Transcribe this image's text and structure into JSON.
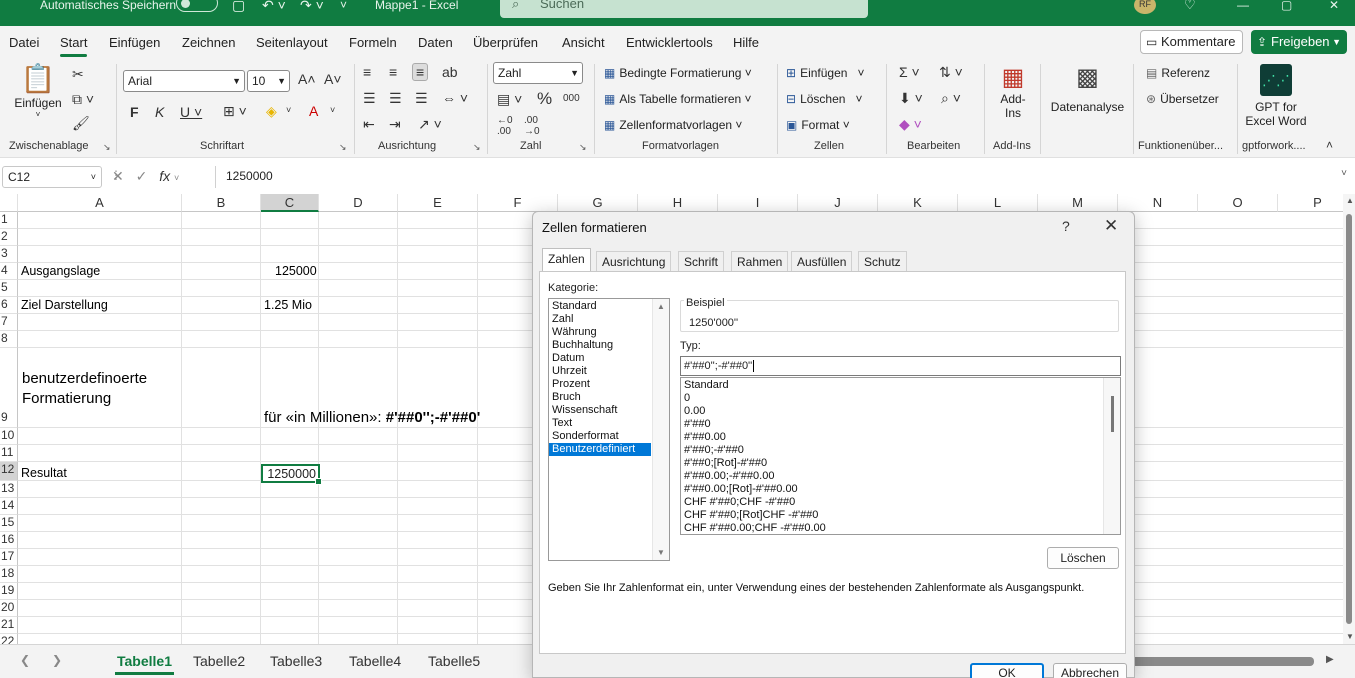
{
  "titlebar": {
    "autosave": "Automatisches Speichern",
    "doc_title": "Mappe1 - Excel",
    "search_placeholder": "Suchen",
    "avatar_initials": "RF"
  },
  "menu": {
    "tabs": [
      "Datei",
      "Start",
      "Einfügen",
      "Zeichnen",
      "Seitenlayout",
      "Formeln",
      "Daten",
      "Überprüfen",
      "Ansicht",
      "Entwicklertools",
      "Hilfe"
    ],
    "active_tab": "Start",
    "kommentare": "Kommentare",
    "freigeben": "Freigeben"
  },
  "ribbon": {
    "paste": "Einfügen",
    "font_name": "Arial",
    "font_size": "10",
    "number_format": "Zahl",
    "bedingte": "Bedingte Formatierung",
    "als_tabelle": "Als Tabelle formatieren",
    "zellenformat": "Zellenformatvorlagen",
    "einfuegen": "Einfügen",
    "loeschen": "Löschen",
    "format": "Format",
    "addins_line1": "Add-",
    "addins_line2": "Ins",
    "datenanalyse": "Datenanalyse",
    "referenz": "Referenz",
    "uebersetzer": "Übersetzer",
    "gpt_line1": "GPT for",
    "gpt_line2": "Excel Word",
    "groups": {
      "zwischenablage": "Zwischenablage",
      "schriftart": "Schriftart",
      "ausrichtung": "Ausrichtung",
      "zahl": "Zahl",
      "formatvorlagen": "Formatvorlagen",
      "zellen": "Zellen",
      "bearbeiten": "Bearbeiten",
      "addins": "Add-Ins",
      "funktionen": "Funktionenüber...",
      "gptforwork": "gptforwork...."
    }
  },
  "formula": {
    "namebox": "C12",
    "value": "1250000"
  },
  "grid": {
    "columns": [
      "A",
      "B",
      "C",
      "D",
      "E",
      "F",
      "G",
      "H",
      "I",
      "J",
      "K",
      "L",
      "M",
      "N",
      "O",
      "P"
    ],
    "selected_column": "C",
    "rows": [
      "1",
      "2",
      "3",
      "4",
      "5",
      "6",
      "7",
      "8",
      "9",
      "10",
      "11",
      "12",
      "13",
      "14",
      "15",
      "16",
      "17",
      "18",
      "19",
      "20",
      "21",
      "22"
    ],
    "selected_row": "12",
    "cells": {
      "a4": "Ausgangslage",
      "c4": "125000",
      "a6": "Ziel Darstellung",
      "c6": "1.25 Mio",
      "a9_line1": "benutzerdefinoerte",
      "a9_line2": "Formatierung",
      "c9_prefix": "für «in Millionen»: ",
      "c9_bold": "#'##0'';-#'##0'",
      "a12": "Resultat",
      "c12": "1250000"
    }
  },
  "sheets": {
    "tabs": [
      "Tabelle1",
      "Tabelle2",
      "Tabelle3",
      "Tabelle4",
      "Tabelle5"
    ],
    "active": "Tabelle1"
  },
  "dialog": {
    "title": "Zellen formatieren",
    "help": "?",
    "tabs": [
      "Zahlen",
      "Ausrichtung",
      "Schrift",
      "Rahmen",
      "Ausfüllen",
      "Schutz"
    ],
    "active_tab": "Zahlen",
    "kategorie_label": "Kategorie:",
    "kategorien": [
      "Standard",
      "Zahl",
      "Währung",
      "Buchhaltung",
      "Datum",
      "Uhrzeit",
      "Prozent",
      "Bruch",
      "Wissenschaft",
      "Text",
      "Sonderformat",
      "Benutzerdefiniert"
    ],
    "selected_kategorie": "Benutzerdefiniert",
    "beispiel_label": "Beispiel",
    "beispiel_value": "1250'000''",
    "typ_label": "Typ:",
    "typ_value": "#'##0'';-#'##0''",
    "typ_list": [
      "Standard",
      "0",
      "0.00",
      "#'##0",
      "#'##0.00",
      "#'##0;-#'##0",
      "#'##0;[Rot]-#'##0",
      "#'##0.00;-#'##0.00",
      "#'##0.00;[Rot]-#'##0.00",
      "CHF #'##0;CHF -#'##0",
      "CHF #'##0;[Rot]CHF -#'##0",
      "CHF #'##0.00;CHF -#'##0.00"
    ],
    "loeschen": "Löschen",
    "hint": "Geben Sie Ihr Zahlenformat ein, unter Verwendung eines der bestehenden Zahlenformate als Ausgangspunkt.",
    "ok": "OK",
    "abbrechen": "Abbrechen"
  }
}
